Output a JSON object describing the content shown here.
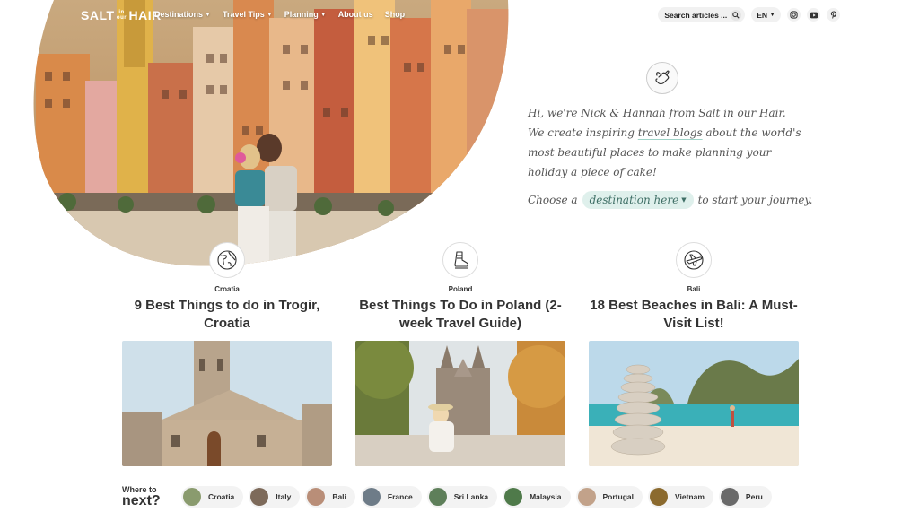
{
  "brand": {
    "logo_left": "SALT",
    "logo_mini": "in our",
    "logo_right": "HAIR"
  },
  "nav": {
    "items": [
      {
        "label": "Destinations",
        "dropdown": true
      },
      {
        "label": "Travel Tips",
        "dropdown": true
      },
      {
        "label": "Planning",
        "dropdown": true
      },
      {
        "label": "About us",
        "dropdown": false
      },
      {
        "label": "Shop",
        "dropdown": false
      }
    ]
  },
  "search": {
    "placeholder": "Search articles ..."
  },
  "language": {
    "current": "EN"
  },
  "social": [
    "instagram-icon",
    "youtube-icon",
    "pinterest-icon"
  ],
  "intro": {
    "line1": "Hi, we're Nick & Hannah from Salt in our Hair.",
    "line2_pre": "We create inspiring ",
    "line2_link": "travel blogs",
    "line2_post": " about the world's most beautiful places to make planning your holiday a piece of cake!",
    "choose_pre": "Choose a",
    "choose_link": "destination here",
    "choose_post": "to start your journey."
  },
  "cards": [
    {
      "country": "Croatia",
      "title": "9 Best Things to do in Trogir, Croatia",
      "icon": "globe-icon"
    },
    {
      "country": "Poland",
      "title": "Best Things To Do in Poland (2-week Travel Guide)",
      "icon": "boot-icon"
    },
    {
      "country": "Bali",
      "title": "18 Best Beaches in Bali: A Must-Visit List!",
      "icon": "plane-icon"
    }
  ],
  "where_next": {
    "small": "Where to",
    "big": "next?",
    "chips": [
      {
        "label": "Croatia",
        "color": "#8a9b6e"
      },
      {
        "label": "Italy",
        "color": "#7d6a5a"
      },
      {
        "label": "Bali",
        "color": "#b98e78"
      },
      {
        "label": "France",
        "color": "#6e7c88"
      },
      {
        "label": "Sri Lanka",
        "color": "#5e7f5a"
      },
      {
        "label": "Malaysia",
        "color": "#4f7a4a"
      },
      {
        "label": "Portugal",
        "color": "#c2a28a"
      },
      {
        "label": "Vietnam",
        "color": "#8b6a2e"
      },
      {
        "label": "Peru",
        "color": "#6a6a6a"
      }
    ]
  },
  "colors": {
    "accent": "#dff0ec",
    "accent_text": "#3f6f66"
  }
}
